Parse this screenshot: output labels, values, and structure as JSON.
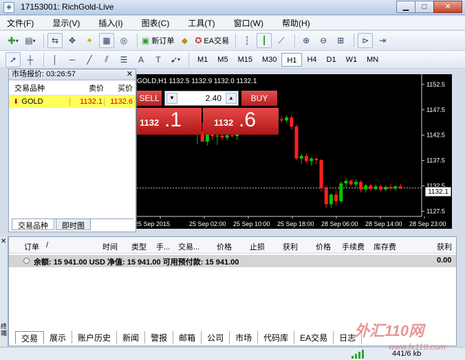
{
  "window": {
    "title": "17153001: RichGold-Live"
  },
  "menu": [
    "文件(F)",
    "显示(V)",
    "插入(I)",
    "图表(C)",
    "工具(T)",
    "窗口(W)",
    "帮助(H)"
  ],
  "toolbar": {
    "new_order": "新订单",
    "ea_trading": "EA交易"
  },
  "timeframes": [
    "M1",
    "M5",
    "M15",
    "M30",
    "H1",
    "H4",
    "D1",
    "W1",
    "MN"
  ],
  "active_timeframe": "H1",
  "market_watch": {
    "title": "市场报价: 03:26:57",
    "columns": [
      "交易品种",
      "卖价",
      "买价"
    ],
    "rows": [
      {
        "symbol": "GOLD",
        "bid": "1132.1",
        "ask": "1132.6"
      }
    ],
    "tabs": [
      "交易品种",
      "即时图"
    ]
  },
  "chart": {
    "symbol_label": "GOLD,H1  1132.5 1132.9 1132.0 1132.1",
    "one_click": {
      "sell_label": "SELL",
      "buy_label": "BUY",
      "lot": "2.40",
      "sell_small": "1132",
      "sell_big": ".1",
      "buy_small": "1132",
      "buy_big": ".6"
    },
    "current_price_tag": "1132.1"
  },
  "chart_data": {
    "type": "candlestick",
    "price_axis": [
      "1152.5",
      "1147.5",
      "1142.5",
      "1137.5",
      "1132.5",
      "1127.5"
    ],
    "ylim": [
      1126.5,
      1154.5
    ],
    "time_axis": [
      "25 Sep 2015",
      "25 Sep 02:00",
      "25 Sep 10:00",
      "25 Sep 18:00",
      "28 Sep 06:00",
      "28 Sep 14:00",
      "28 Sep 23:00"
    ],
    "colors": {
      "up": "#00c800",
      "down": "#ff2020",
      "bg": "#000000",
      "grid": "#c0c0c0"
    },
    "candles": [
      {
        "o": 1142.6,
        "h": 1144.0,
        "l": 1140.8,
        "c": 1143.2
      },
      {
        "o": 1143.2,
        "h": 1145.0,
        "l": 1141.8,
        "c": 1141.2
      },
      {
        "o": 1141.2,
        "h": 1143.8,
        "l": 1140.5,
        "c": 1143.4
      },
      {
        "o": 1143.4,
        "h": 1143.6,
        "l": 1141.6,
        "c": 1142.3
      },
      {
        "o": 1142.3,
        "h": 1143.2,
        "l": 1140.6,
        "c": 1142.4
      },
      {
        "o": 1142.4,
        "h": 1143.0,
        "l": 1141.5,
        "c": 1142.0
      },
      {
        "o": 1142.0,
        "h": 1142.9,
        "l": 1141.5,
        "c": 1142.5
      },
      {
        "o": 1142.5,
        "h": 1142.7,
        "l": 1142.0,
        "c": 1142.3
      },
      {
        "o": 1142.3,
        "h": 1144.5,
        "l": 1141.6,
        "c": 1143.8
      },
      {
        "o": 1143.8,
        "h": 1145.2,
        "l": 1143.2,
        "c": 1144.5
      },
      {
        "o": 1144.5,
        "h": 1146.0,
        "l": 1143.8,
        "c": 1145.2
      },
      {
        "o": 1145.2,
        "h": 1146.6,
        "l": 1144.6,
        "c": 1146.0
      },
      {
        "o": 1146.0,
        "h": 1147.2,
        "l": 1145.2,
        "c": 1145.6
      },
      {
        "o": 1145.6,
        "h": 1146.2,
        "l": 1144.2,
        "c": 1144.8
      },
      {
        "o": 1144.8,
        "h": 1145.4,
        "l": 1143.6,
        "c": 1144.3
      },
      {
        "o": 1144.3,
        "h": 1145.0,
        "l": 1143.3,
        "c": 1144.6
      },
      {
        "o": 1144.6,
        "h": 1146.0,
        "l": 1144.0,
        "c": 1145.6
      },
      {
        "o": 1145.6,
        "h": 1146.2,
        "l": 1145.0,
        "c": 1145.4
      },
      {
        "o": 1145.4,
        "h": 1146.4,
        "l": 1145.0,
        "c": 1146.0
      },
      {
        "o": 1146.0,
        "h": 1146.4,
        "l": 1143.6,
        "c": 1144.2
      },
      {
        "o": 1144.2,
        "h": 1144.6,
        "l": 1137.6,
        "c": 1137.9
      },
      {
        "o": 1137.9,
        "h": 1138.8,
        "l": 1136.8,
        "c": 1138.4
      },
      {
        "o": 1138.4,
        "h": 1138.9,
        "l": 1137.0,
        "c": 1137.4
      },
      {
        "o": 1137.4,
        "h": 1138.2,
        "l": 1136.5,
        "c": 1137.9
      },
      {
        "o": 1137.9,
        "h": 1138.0,
        "l": 1136.8,
        "c": 1137.6
      },
      {
        "o": 1137.6,
        "h": 1137.8,
        "l": 1131.4,
        "c": 1132.0
      },
      {
        "o": 1132.0,
        "h": 1132.6,
        "l": 1128.2,
        "c": 1128.9
      },
      {
        "o": 1128.9,
        "h": 1131.0,
        "l": 1128.2,
        "c": 1130.8
      },
      {
        "o": 1130.8,
        "h": 1131.6,
        "l": 1128.6,
        "c": 1129.5
      },
      {
        "o": 1129.5,
        "h": 1133.4,
        "l": 1129.2,
        "c": 1133.0
      },
      {
        "o": 1133.0,
        "h": 1134.0,
        "l": 1132.2,
        "c": 1133.5
      },
      {
        "o": 1133.5,
        "h": 1133.8,
        "l": 1132.5,
        "c": 1132.8
      },
      {
        "o": 1132.8,
        "h": 1133.8,
        "l": 1132.2,
        "c": 1133.3
      },
      {
        "o": 1133.3,
        "h": 1133.6,
        "l": 1131.2,
        "c": 1131.8
      },
      {
        "o": 1131.8,
        "h": 1132.9,
        "l": 1131.2,
        "c": 1132.6
      },
      {
        "o": 1132.6,
        "h": 1133.0,
        "l": 1131.5,
        "c": 1131.9
      },
      {
        "o": 1131.9,
        "h": 1132.8,
        "l": 1131.6,
        "c": 1132.4
      },
      {
        "o": 1132.4,
        "h": 1132.7,
        "l": 1131.4,
        "c": 1131.8
      },
      {
        "o": 1131.8,
        "h": 1132.6,
        "l": 1131.5,
        "c": 1132.3
      },
      {
        "o": 1132.3,
        "h": 1132.9,
        "l": 1131.7,
        "c": 1132.0
      },
      {
        "o": 1132.0,
        "h": 1132.6,
        "l": 1131.6,
        "c": 1132.4
      },
      {
        "o": 1132.4,
        "h": 1132.9,
        "l": 1131.8,
        "c": 1132.1
      }
    ]
  },
  "terminal": {
    "columns": [
      "订单",
      "/",
      "时间",
      "类型",
      "手...",
      "交易...",
      "价格",
      "止损",
      "获利",
      "价格",
      "手续费",
      "库存费",
      "获利"
    ],
    "balance_line": "余额: 15 941.00 USD  净值: 15 941.00  可用预付款: 15 941.00",
    "balance_total": "0.00",
    "tabs": [
      "交易",
      "展示",
      "账户历史",
      "新闻",
      "警报",
      "邮箱",
      "公司",
      "市场",
      "代码库",
      "EA交易",
      "日志"
    ],
    "side_label": "终端"
  },
  "status": {
    "traffic": "441/6 kb"
  },
  "watermark": {
    "brand": "外汇110网",
    "url": "www.fx110.com"
  }
}
